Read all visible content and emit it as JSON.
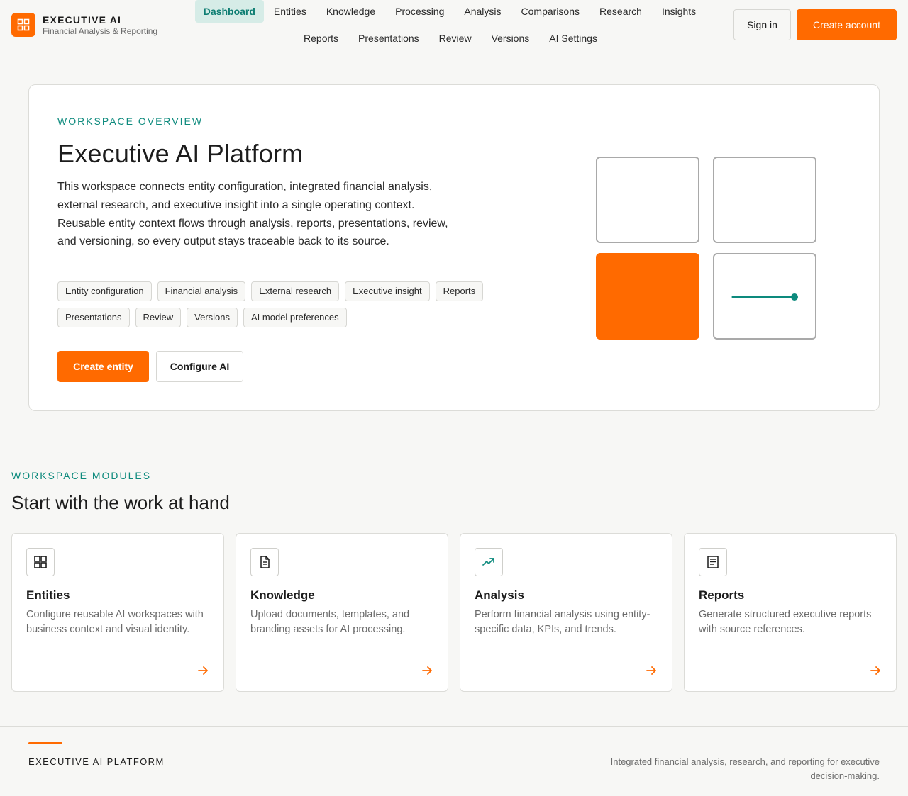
{
  "brand": {
    "name": "EXECUTIVE AI",
    "subtitle": "Financial Analysis & Reporting",
    "icon": "grid-icon",
    "accent_color": "#ff6a00"
  },
  "nav": {
    "row1": [
      "Dashboard",
      "Entities",
      "Knowledge",
      "Processing",
      "Analysis",
      "Comparisons",
      "Research",
      "Insights"
    ],
    "row2": [
      "Reports",
      "Presentations",
      "Review",
      "Versions",
      "AI Settings"
    ],
    "active": "Dashboard",
    "active_color": "#0d7d72"
  },
  "auth": {
    "sign_in": "Sign in",
    "create_account": "Create account"
  },
  "hero": {
    "eyebrow": "WORKSPACE OVERVIEW",
    "title": "Executive AI Platform",
    "description": "This workspace connects entity configuration, integrated financial analysis, external research, and executive insight into a single operating context. Reusable entity context flows through analysis, reports, presentations, review, and versioning, so every output stays traceable back to its source.",
    "chips": [
      "Entity configuration",
      "Financial analysis",
      "External research",
      "Executive insight",
      "Reports",
      "Presentations",
      "Review",
      "Versions",
      "AI model preferences"
    ],
    "primary_button": "Create entity",
    "secondary_button": "Configure AI"
  },
  "modules": {
    "eyebrow": "WORKSPACE MODULES",
    "title": "Start with the work at hand",
    "cards": [
      {
        "title": "Entities",
        "description": "Configure reusable AI workspaces with business context and visual identity.",
        "icon": "grid-icon"
      },
      {
        "title": "Knowledge",
        "description": "Upload documents, templates, and branding assets for AI processing.",
        "icon": "document-icon"
      },
      {
        "title": "Analysis",
        "description": "Perform financial analysis using entity-specific data, KPIs, and trends.",
        "icon": "trending-up-icon"
      },
      {
        "title": "Reports",
        "description": "Generate structured executive reports with source references.",
        "icon": "report-icon"
      }
    ]
  },
  "footer": {
    "brand": "EXECUTIVE AI PLATFORM",
    "tagline": "Integrated financial analysis, research, and reporting for executive decision-making."
  }
}
